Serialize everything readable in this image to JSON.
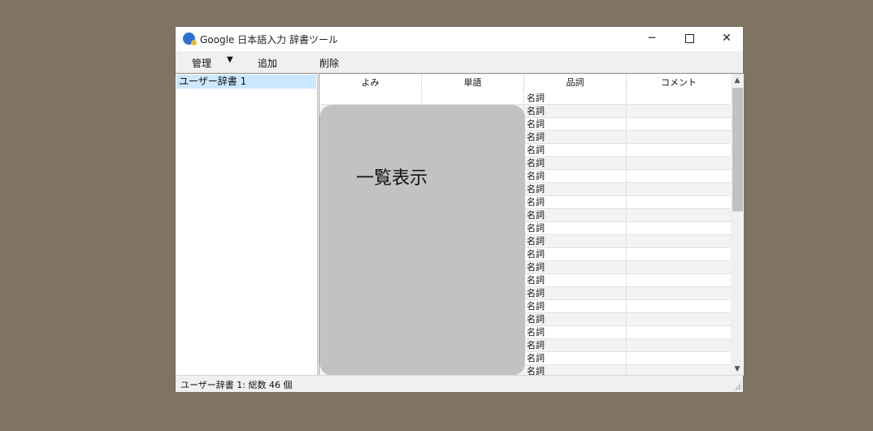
{
  "window": {
    "title": "Google 日本語入力 辞書ツール",
    "minimize_glyph": "─",
    "close_glyph": "✕"
  },
  "toolbar": {
    "manage_label": "管理",
    "manage_arrow": "▼",
    "add_label": "追加",
    "delete_label": "削除"
  },
  "dictionaries": [
    {
      "label": "ユーザー辞書 1",
      "selected": true
    }
  ],
  "grid": {
    "columns": [
      "よみ",
      "単語",
      "品詞",
      "コメント"
    ],
    "rows": [
      {
        "pos": "名詞"
      },
      {
        "pos": "名詞"
      },
      {
        "pos": "名詞"
      },
      {
        "pos": "名詞"
      },
      {
        "pos": "名詞"
      },
      {
        "pos": "名詞"
      },
      {
        "pos": "名詞"
      },
      {
        "pos": "名詞"
      },
      {
        "pos": "名詞"
      },
      {
        "pos": "名詞"
      },
      {
        "pos": "名詞"
      },
      {
        "pos": "名詞"
      },
      {
        "pos": "名詞"
      },
      {
        "pos": "名詞"
      },
      {
        "pos": "名詞"
      },
      {
        "pos": "名詞"
      },
      {
        "pos": "名詞"
      },
      {
        "pos": "名詞"
      },
      {
        "pos": "名詞"
      },
      {
        "pos": "名詞"
      },
      {
        "pos": "名詞"
      },
      {
        "pos": "名詞"
      }
    ]
  },
  "overlay": {
    "label": "一覧表示",
    "color": "#c2c2c2"
  },
  "scrollbar": {
    "up_glyph": "▲",
    "down_glyph": "▼"
  },
  "status": {
    "text": "ユーザー辞書 1: 総数 46 個"
  },
  "colors": {
    "desktop": "#7f7461",
    "selection": "#cce8ff"
  }
}
